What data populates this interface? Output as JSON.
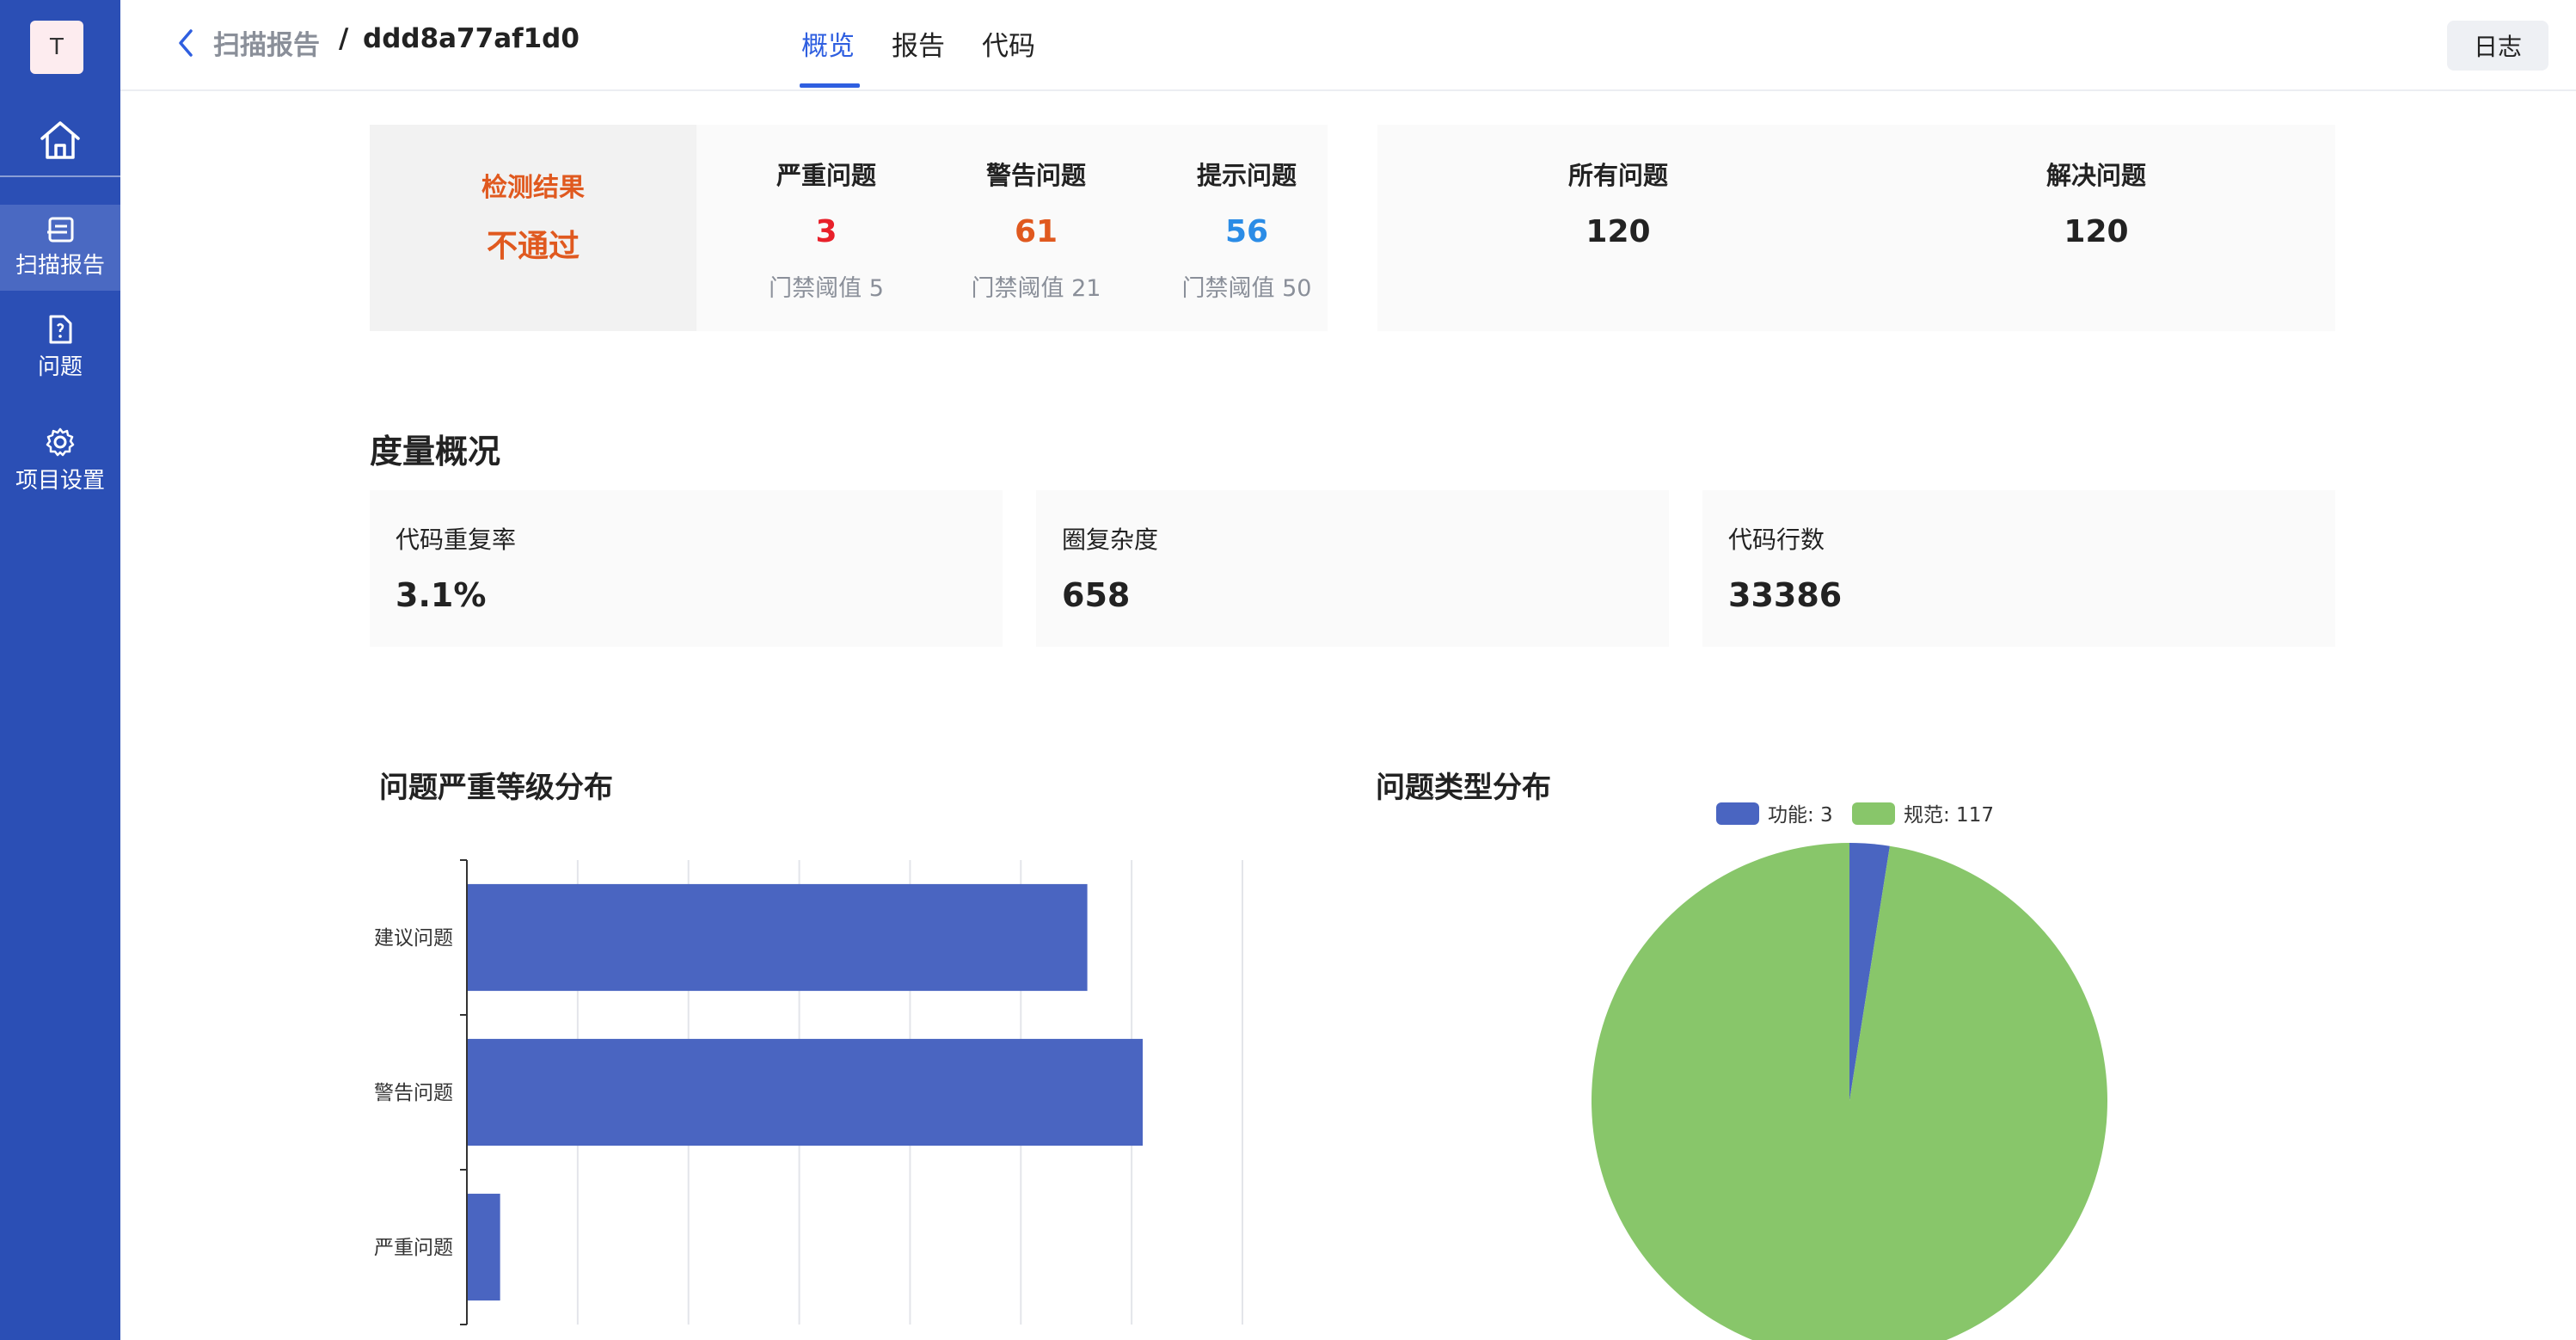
{
  "app": {
    "avatar_letter": "T"
  },
  "sidebar": {
    "items": [
      {
        "label": "扫描报告",
        "icon": "report-icon",
        "active": true
      },
      {
        "label": "问题",
        "icon": "issue-file-icon",
        "active": false
      },
      {
        "label": "项目设置",
        "icon": "gear-icon",
        "active": false
      }
    ]
  },
  "header": {
    "breadcrumb_parent": "扫描报告",
    "breadcrumb_sep": "/",
    "breadcrumb_current": "ddd8a77af1d0",
    "tabs": [
      {
        "label": "概览",
        "active": true
      },
      {
        "label": "报告",
        "active": false
      },
      {
        "label": "代码",
        "active": false
      }
    ],
    "log_button": "日志"
  },
  "summary": {
    "result_label": "检测结果",
    "result_value": "不通过",
    "metrics": [
      {
        "title": "严重问题",
        "value": "3",
        "gate": "门禁阈值 5",
        "color": "#e8202a"
      },
      {
        "title": "警告问题",
        "value": "61",
        "gate": "门禁阈值 21",
        "color": "#e0591f"
      },
      {
        "title": "提示问题",
        "value": "56",
        "gate": "门禁阈值 50",
        "color": "#2b8ce6"
      }
    ],
    "totals": [
      {
        "title": "所有问题",
        "value": "120"
      },
      {
        "title": "解决问题",
        "value": "120"
      }
    ]
  },
  "measures": {
    "title": "度量概况",
    "cards": [
      {
        "title": "代码重复率",
        "value": "3.1%"
      },
      {
        "title": "圈复杂度",
        "value": "658"
      },
      {
        "title": "代码行数",
        "value": "33386"
      }
    ]
  },
  "charts": {
    "severity_title": "问题严重等级分布",
    "type_title": "问题类型分布"
  },
  "chart_data": [
    {
      "type": "bar",
      "orientation": "horizontal",
      "categories": [
        "建议问题",
        "警告问题",
        "严重问题"
      ],
      "values": [
        56,
        61,
        3
      ],
      "color": "#4a65c1",
      "xlim": [
        0,
        70
      ],
      "grid": true
    },
    {
      "type": "pie",
      "labels": [
        "功能",
        "规范"
      ],
      "values": [
        3,
        117
      ],
      "legend_text": [
        "功能: 3",
        "规范: 117"
      ],
      "colors": [
        "#4a65c1",
        "#88c66a"
      ],
      "legend": "top"
    }
  ]
}
